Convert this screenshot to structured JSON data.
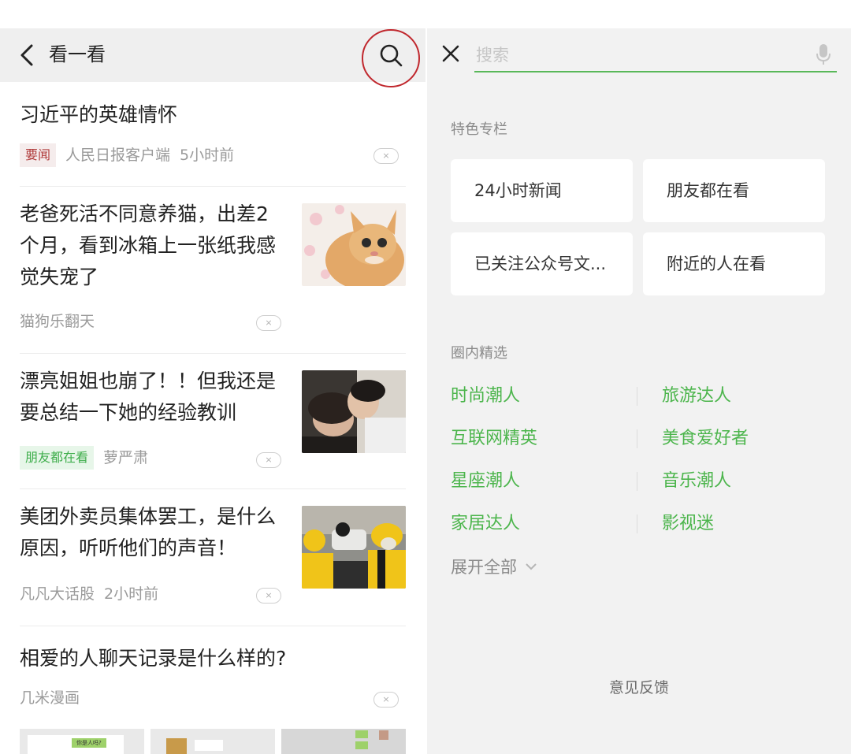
{
  "left": {
    "title": "看一看",
    "feed": [
      {
        "title": [
          "习近平的英雄情怀"
        ],
        "tag": "要闻",
        "source": "人民日报客户端",
        "time": "5小时前"
      },
      {
        "title": [
          "老爸死活不同意养猫，出差2",
          "个月，看到冰箱上一张纸我感",
          "觉失宠了"
        ],
        "source": "猫狗乐翻天",
        "thumb": "cat-photo"
      },
      {
        "title": [
          "漂亮姐姐也崩了！！但我还是",
          "要总结一下她的经验教训"
        ],
        "tag": "朋友都在看",
        "source": "萝严肃",
        "thumb": "couple-photo"
      },
      {
        "title": [
          "美团外卖员集体罢工，是什么",
          "原因，听听他们的声音！"
        ],
        "source": "凡凡大话股",
        "time": "2小时前",
        "thumb": "delivery-photo"
      },
      {
        "title": [
          "相爱的人聊天记录是什么样的?"
        ],
        "source": "几米漫画"
      }
    ],
    "comic_text": "你是人吗?",
    "close_glyph": "×"
  },
  "right": {
    "search_placeholder": "搜索",
    "section1_label": "特色专栏",
    "cards": [
      "24小时新闻",
      "朋友都在看",
      "已关注公众号文...",
      "附近的人在看"
    ],
    "section2_label": "圈内精选",
    "circles": [
      [
        "时尚潮人",
        "旅游达人"
      ],
      [
        "互联网精英",
        "美食爱好者"
      ],
      [
        "星座潮人",
        "音乐潮人"
      ],
      [
        "家居达人",
        "影视迷"
      ]
    ],
    "expand_label": "展开全部",
    "feedback_label": "意见反馈"
  },
  "colors": {
    "accent_green": "#4cb54c",
    "highlight_circle": "#c0272d",
    "tag_red": "#b03a3a"
  }
}
